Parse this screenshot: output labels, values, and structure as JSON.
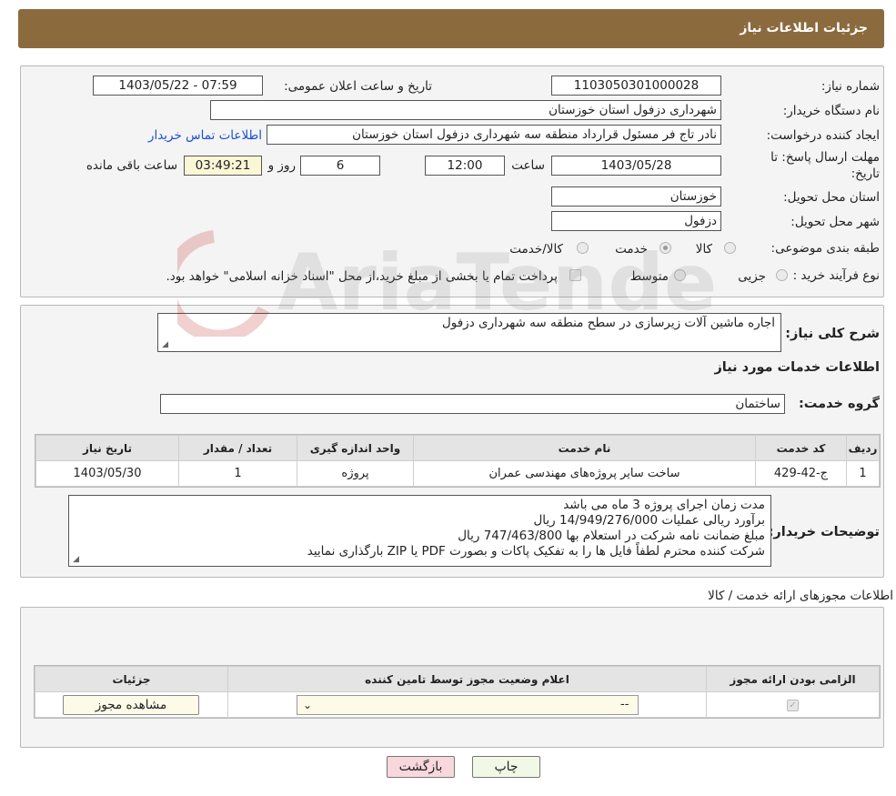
{
  "header": {
    "title": "جزئیات اطلاعات نیاز"
  },
  "form": {
    "need_number_label": "شماره نیاز:",
    "need_number": "1103050301000028",
    "announce_label": "تاریخ و ساعت اعلان عمومی:",
    "announce_value": "1403/05/22 - 07:59",
    "buyer_org_label": "نام دستگاه خریدار:",
    "buyer_org": "شهرداری دزفول استان خوزستان",
    "creator_label": "ایجاد کننده درخواست:",
    "creator": "نادر تاج فر مسئول قرارداد منطقه سه شهرداری دزفول استان خوزستان",
    "contact_link": "اطلاعات تماس خریدار",
    "deadline_label": "مهلت ارسال پاسخ: تا تاریخ:",
    "deadline_date": "1403/05/28",
    "time_label": "ساعت",
    "deadline_time": "12:00",
    "days_value": "6",
    "days_label": "روز و",
    "remaining_time": "03:49:21",
    "remaining_label": "ساعت باقی مانده",
    "province_label": "استان محل تحویل:",
    "province": "خوزستان",
    "city_label": "شهر محل تحویل:",
    "city": "دزفول",
    "category_label": "طبقه بندی موضوعی:",
    "category_options": [
      "کالا",
      "خدمت",
      "کالا/خدمت"
    ],
    "process_label": "نوع فرآیند خرید :",
    "process_options": [
      "جزیی",
      "متوسط"
    ],
    "payment_note": "پرداخت تمام یا بخشی از مبلغ خرید،از محل \"اسناد خزانه اسلامی\" خواهد بود."
  },
  "summary": {
    "label": "شرح کلی نیاز:",
    "text": "اجاره ماشین آلات زیرسازی در سطح منطقه سه شهرداری دزفول",
    "services_heading": "اطلاعات خدمات مورد نیاز",
    "group_label": "گروه خدمت:",
    "group_value": "ساختمان"
  },
  "services_table": {
    "headers": [
      "ردیف",
      "کد خدمت",
      "نام خدمت",
      "واحد اندازه گیری",
      "تعداد / مقدار",
      "تاریخ نیاز"
    ],
    "rows": [
      [
        "1",
        "ج-42-429",
        "ساخت سایر پروژه‌های مهندسی عمران",
        "پروژه",
        "1",
        "1403/05/30"
      ]
    ]
  },
  "buyer_notes": {
    "label": "توضیحات خریدار:",
    "lines": [
      "مدت زمان اجرای پروژه 3 ماه می باشد",
      "برآورد ریالی عملیات 14/949/276/000 ریال",
      "مبلغ ضمانت نامه شرکت در استعلام بها 747/463/800 ریال",
      "شرکت کننده محترم لطفاً فایل ها را به تفکیک پاکات و بصورت PDF یا ZIP بارگذاری نمایید"
    ]
  },
  "permits": {
    "heading": "اطلاعات مجوزهای ارائه خدمت / کالا",
    "headers": [
      "الزامی بودن ارائه مجوز",
      "اعلام وضعیت مجوز توسط تامین کننده",
      "جزئیات"
    ],
    "select_value": "--",
    "view_button": "مشاهده مجوز"
  },
  "footer": {
    "print_button": "چاپ",
    "back_button": "بازگشت"
  },
  "watermark": "AriaTender.neT"
}
